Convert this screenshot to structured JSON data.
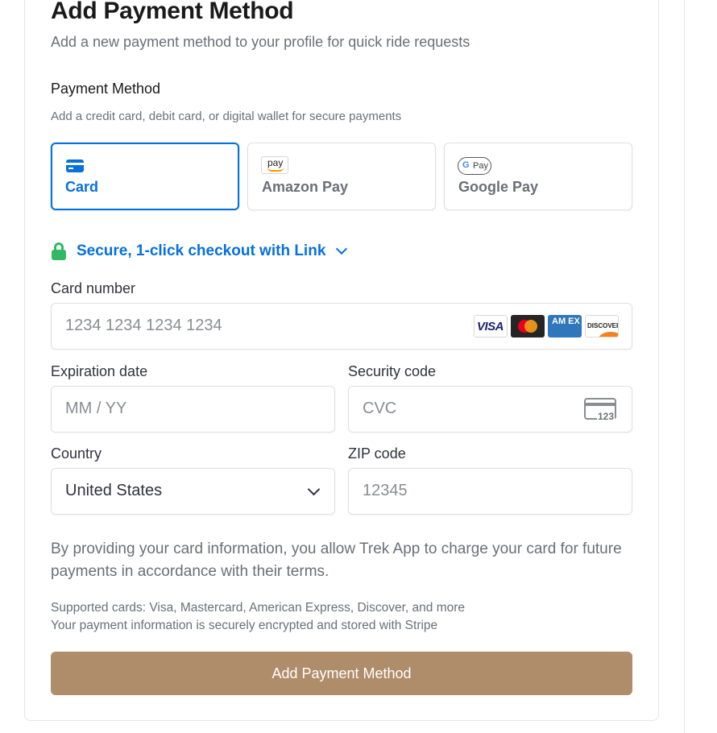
{
  "header": {
    "title": "Add Payment Method",
    "subtitle": "Add a new payment method to your profile for quick ride requests"
  },
  "payment_section": {
    "title": "Payment Method",
    "description": "Add a credit card, debit card, or digital wallet for secure payments"
  },
  "tabs": [
    {
      "label": "Card",
      "icon": "credit-card-icon",
      "selected": true
    },
    {
      "label": "Amazon Pay",
      "icon": "amazon-pay-icon",
      "selected": false
    },
    {
      "label": "Google Pay",
      "icon": "google-pay-icon",
      "selected": false
    }
  ],
  "tab_icons": {
    "amazon_text": "pay",
    "google_g": "G",
    "google_text": "Pay"
  },
  "link": {
    "label": "Secure, 1-click checkout with Link",
    "icon": "lock-icon"
  },
  "fields": {
    "card_number": {
      "label": "Card number",
      "placeholder": "1234 1234 1234 1234"
    },
    "expiration": {
      "label": "Expiration date",
      "placeholder": "MM / YY"
    },
    "security": {
      "label": "Security code",
      "placeholder": "CVC",
      "icon_text": "123"
    },
    "country": {
      "label": "Country",
      "value": "United States"
    },
    "zip": {
      "label": "ZIP code",
      "placeholder": "12345"
    }
  },
  "card_brands": {
    "visa": "VISA",
    "amex": "AM EX",
    "discover": "DISCOVER"
  },
  "terms": "By providing your card information, you allow Trek App to charge your card for future payments in accordance with their terms.",
  "notes": {
    "supported": "Supported cards: Visa, Mastercard, American Express, Discover, and more",
    "security": "Your payment information is securely encrypted and stored with Stripe"
  },
  "submit": {
    "label": "Add Payment Method"
  },
  "colors": {
    "accent": "#0570de",
    "submit_bg": "#b08d6a",
    "lock": "#33b964",
    "muted_text": "#6b6f76"
  }
}
